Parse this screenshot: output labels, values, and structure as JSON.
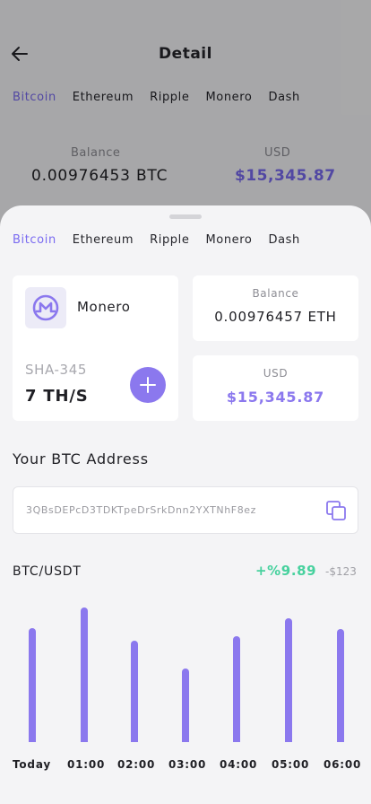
{
  "background_page": {
    "title": "Detail",
    "tabs": [
      {
        "label": "Bitcoin",
        "active": true
      },
      {
        "label": "Ethereum",
        "active": false
      },
      {
        "label": "Ripple",
        "active": false
      },
      {
        "label": "Monero",
        "active": false
      },
      {
        "label": "Dash",
        "active": false
      }
    ],
    "balance_label": "Balance",
    "balance_value": "0.00976453 BTC",
    "usd_label": "USD",
    "usd_value": "$15,345.87"
  },
  "sheet": {
    "tabs": [
      {
        "label": "Bitcoin",
        "active": true
      },
      {
        "label": "Ethereum",
        "active": false
      },
      {
        "label": "Ripple",
        "active": false
      },
      {
        "label": "Monero",
        "active": false
      },
      {
        "label": "Dash",
        "active": false
      }
    ],
    "coin_card": {
      "name": "Monero",
      "icon": "monero-icon",
      "algorithm": "SHA-345",
      "hashrate": "7 TH/S"
    },
    "balance_card": {
      "label": "Balance",
      "value": "0.00976457 ETH"
    },
    "usd_card": {
      "label": "USD",
      "value": "$15,345.87"
    },
    "address": {
      "title": "Your BTC Address",
      "value": "3QBsDEPcD3TDKTpeDrSrkDnn2YXTNhF8ez"
    },
    "market": {
      "pair": "BTC/USDT",
      "change": "+%9.89",
      "delta": "-$123"
    }
  },
  "colors": {
    "accent": "#8b78ee",
    "positive": "#47d19e"
  },
  "chart_data": {
    "type": "bar",
    "categories": [
      "Today",
      "01:00",
      "02:00",
      "03:00",
      "04:00",
      "05:00",
      "06:00"
    ],
    "values": [
      127,
      150,
      113,
      82,
      118,
      138,
      126
    ],
    "ylim": [
      0,
      150
    ]
  }
}
